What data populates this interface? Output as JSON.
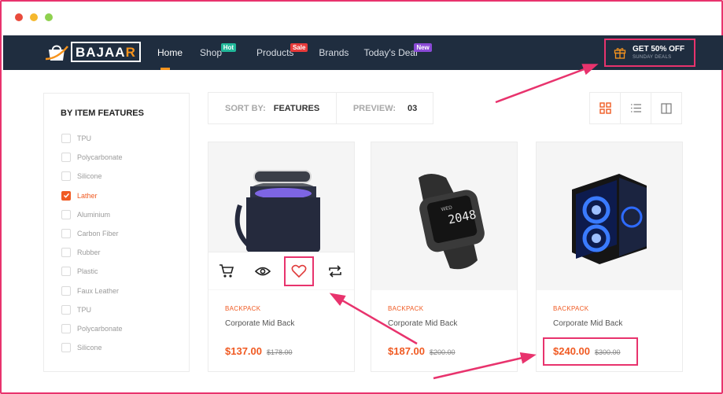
{
  "brand": {
    "name_main": "BAJAA",
    "name_accent": "R"
  },
  "nav": [
    {
      "label": "Home",
      "badge": null,
      "active": true
    },
    {
      "label": "Shop",
      "badge": "Hot"
    },
    {
      "label": "Products",
      "badge": "Sale"
    },
    {
      "label": "Brands",
      "badge": null
    },
    {
      "label": "Today's Deal",
      "badge": "New"
    }
  ],
  "deal": {
    "title": "GET 50% OFF",
    "subtitle": "SUNDAY DEALS"
  },
  "sidebar": {
    "title": "BY ITEM FEATURES",
    "items": [
      {
        "label": "TPU",
        "checked": false
      },
      {
        "label": "Polycarbonate",
        "checked": false
      },
      {
        "label": "Silicone",
        "checked": false
      },
      {
        "label": "Lather",
        "checked": true
      },
      {
        "label": "Aluminium",
        "checked": false
      },
      {
        "label": "Carbon Fiber",
        "checked": false
      },
      {
        "label": "Rubber",
        "checked": false
      },
      {
        "label": "Plastic",
        "checked": false
      },
      {
        "label": "Faux Leather",
        "checked": false
      },
      {
        "label": "TPU",
        "checked": false
      },
      {
        "label": "Polycarbonate",
        "checked": false
      },
      {
        "label": "Silicone",
        "checked": false
      }
    ]
  },
  "toolbar": {
    "sort_label": "SORT BY:",
    "sort_value": "FEATURES",
    "preview_label": "PREVIEW:",
    "preview_value": "03"
  },
  "products": [
    {
      "category": "BACKPACK",
      "name": "Corporate Mid Back",
      "price": "$137.00",
      "old_price": "$178.00",
      "icon": "lamp-image"
    },
    {
      "category": "BACKPACK",
      "name": "Corporate Mid Back",
      "price": "$187.00",
      "old_price": "$200.00",
      "icon": "smartwatch-image"
    },
    {
      "category": "BACKPACK",
      "name": "Corporate Mid Back",
      "price": "$240.00",
      "old_price": "$300.00",
      "icon": "pc-case-image"
    }
  ],
  "watch_display": {
    "top": "WED",
    "time": "2048"
  },
  "colors": {
    "accent": "#f05a22",
    "nav_bg": "#1f2d3f",
    "highlight": "#e8336d"
  }
}
